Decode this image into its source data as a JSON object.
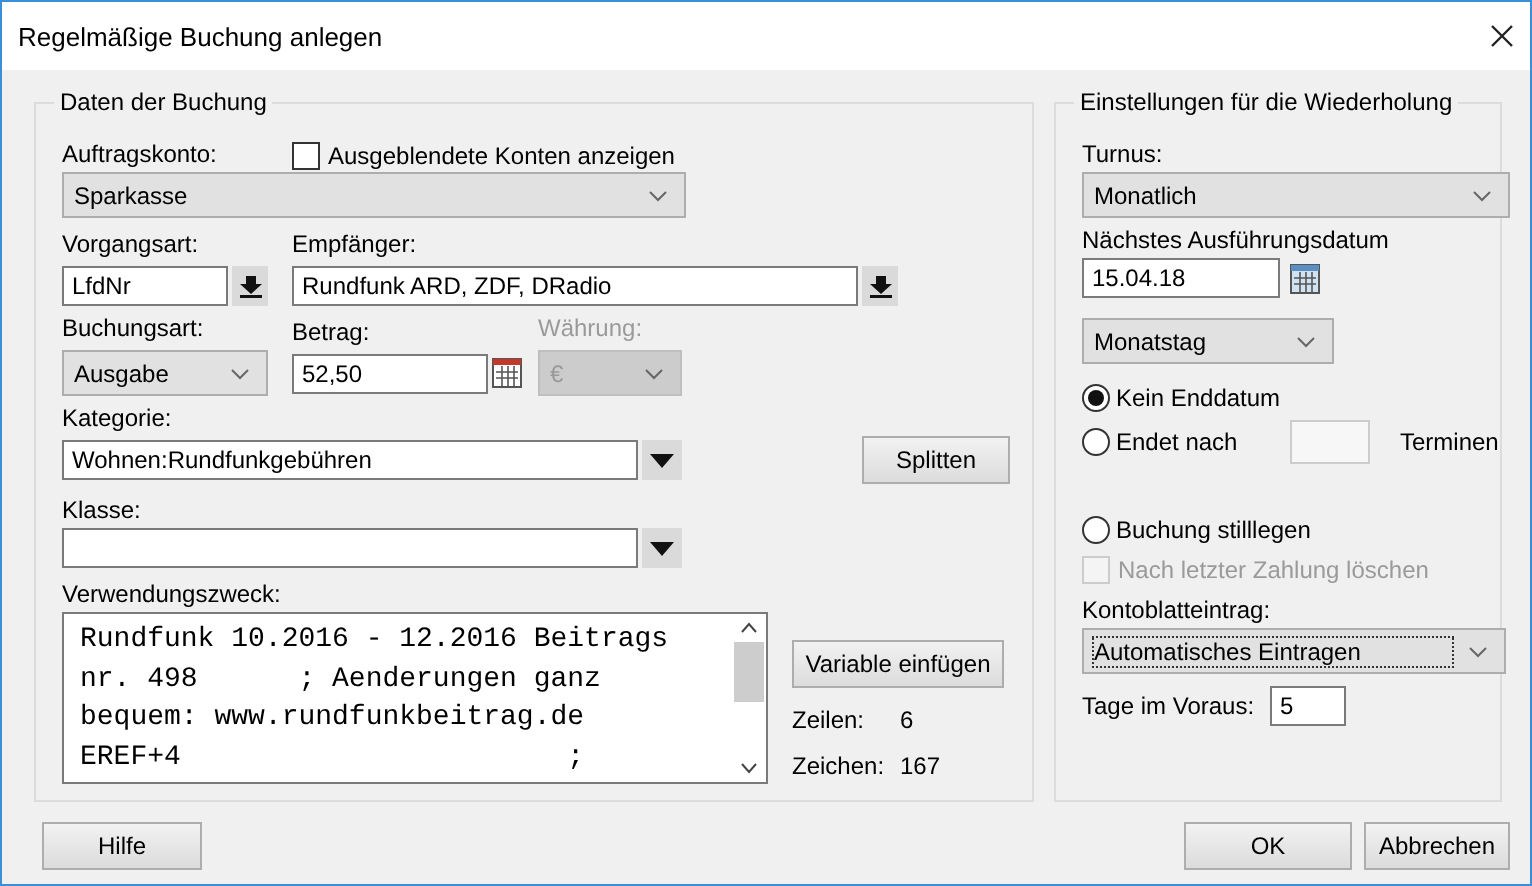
{
  "window": {
    "title": "Regelmäßige Buchung anlegen"
  },
  "booking": {
    "title": "Daten der Buchung",
    "account": {
      "label": "Auftragskonto:",
      "value": "Sparkasse"
    },
    "show_hidden": {
      "label": "Ausgeblendete Konten anzeigen",
      "checked": false
    },
    "type": {
      "label": "Vorgangsart:",
      "value": "LfdNr"
    },
    "payee": {
      "label": "Empfänger:",
      "value": "Rundfunk ARD, ZDF, DRadio"
    },
    "booking_type": {
      "label": "Buchungsart:",
      "value": "Ausgabe"
    },
    "amount": {
      "label": "Betrag:",
      "value": "52,50"
    },
    "currency": {
      "label": "Währung:",
      "value": "€",
      "disabled": true
    },
    "category": {
      "label": "Kategorie:",
      "value": "Wohnen:Rundfunkgebühren"
    },
    "split_button": "Splitten",
    "class": {
      "label": "Klasse:"
    },
    "purpose": {
      "label": "Verwendungszweck:",
      "lines": [
        "Rundfunk 10.2016 - 12.2016 Beitrags",
        "nr. 498      ; Aenderungen ganz",
        "bequem: www.rundfunkbeitrag.de",
        "EREF+4                       ;"
      ]
    },
    "variable_button": "Variable einfügen",
    "stats": [
      {
        "label": "Zeilen:",
        "value": "6"
      },
      {
        "label": "Zeichen:",
        "value": "167"
      }
    ]
  },
  "repeat": {
    "title": "Einstellungen für die Wiederholung",
    "interval": {
      "label": "Turnus:",
      "value": "Monatlich"
    },
    "next_date": {
      "label": "Nächstes Ausführungsdatum",
      "value": "15.04.18"
    },
    "day_mode": {
      "value": "Monatstag"
    },
    "end_options": [
      {
        "kind": "plain",
        "label": "Kein Enddatum",
        "selected": true
      },
      {
        "kind": "count",
        "label": "Endet nach",
        "suffix": "Terminen",
        "selected": false
      },
      {
        "kind": "pause",
        "label": "Buchung stilllegen",
        "selected": false
      }
    ],
    "delete_after": {
      "label": "Nach letzter Zahlung löschen",
      "checked": false,
      "disabled": true
    },
    "ledger": {
      "label": "Kontoblatteintrag:",
      "value": "Automatisches Eintragen"
    },
    "days_ahead": {
      "label": "Tage im Voraus:",
      "value": "5"
    }
  },
  "buttons": {
    "help": "Hilfe",
    "ok": "OK",
    "cancel": "Abbrechen"
  }
}
